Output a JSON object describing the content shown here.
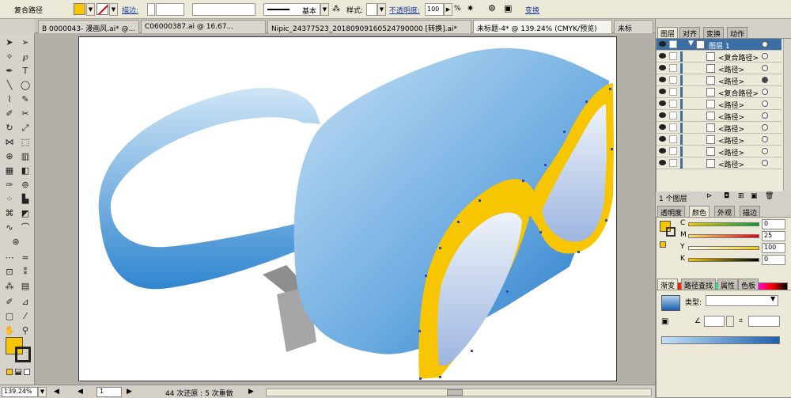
{
  "control_bar": {
    "object_type": "复合路径",
    "stroke_label": "描边:",
    "stroke_profile": "基本",
    "style_label": "样式:",
    "opacity_label": "不透明度:",
    "opacity_value": "100",
    "opacity_unit": "%",
    "transform_label": "变换"
  },
  "tabs": [
    {
      "label": "B 0000043- 漫画风.ai* @...",
      "active": false
    },
    {
      "label": "C06000387.ai @ 16.67...",
      "active": false
    },
    {
      "label": "Nipic_24377523_20180909160524790000 [转换].ai*",
      "active": false
    },
    {
      "label": "未标题-4* @ 139.24% (CMYK/预览)",
      "active": true
    },
    {
      "label": "未标",
      "active": false
    }
  ],
  "status": {
    "zoom": "139.24%",
    "page": "1",
    "history": "44 次还原 : 5 次重做"
  },
  "layers_panel": {
    "tabs": [
      "图层",
      "对齐",
      "变换",
      "动作"
    ],
    "rows": [
      {
        "name": "图层 1",
        "top": true
      },
      {
        "name": "<复合路径>",
        "filled": false
      },
      {
        "name": "<路径>",
        "filled": false
      },
      {
        "name": "<路径>",
        "filled": true
      },
      {
        "name": "<复合路径>",
        "filled": false
      },
      {
        "name": "<路径>",
        "filled": false
      },
      {
        "name": "<路径>",
        "filled": false
      },
      {
        "name": "<路径>",
        "filled": false
      },
      {
        "name": "<路径>",
        "filled": false
      },
      {
        "name": "<路径>",
        "filled": false
      },
      {
        "name": "<路径>",
        "filled": false
      }
    ],
    "footer": "1 个图层"
  },
  "color_panel": {
    "tabs": [
      "透明度",
      "颜色",
      "外观",
      "描边"
    ],
    "channels": [
      {
        "name": "C",
        "value": "0"
      },
      {
        "name": "M",
        "value": "25"
      },
      {
        "name": "Y",
        "value": "100"
      },
      {
        "name": "K",
        "value": "0"
      }
    ]
  },
  "gradient_panel": {
    "tabs": [
      "渐变",
      "路径查找",
      "属性",
      "色板"
    ],
    "type_label": "类型:"
  },
  "colors": {
    "fill": "#f7c600",
    "ui_bg": "#d4d0c8",
    "accent": "#3a6ea5"
  }
}
